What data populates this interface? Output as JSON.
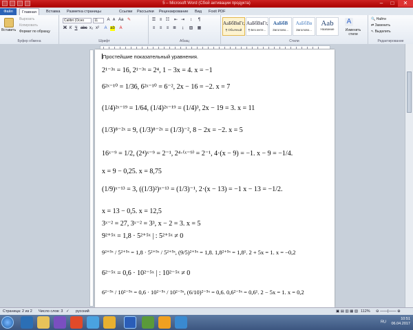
{
  "window": {
    "title": "Microsoft Word (Сбой активации продукта)",
    "title_prefix": "5",
    "controls": [
      "–",
      "□",
      "✕"
    ]
  },
  "tabs": [
    "Файл",
    "Главная",
    "Вставка",
    "Разметка страницы",
    "Ссылки",
    "Рассылки",
    "Рецензирование",
    "Вид",
    "Foxit PDF"
  ],
  "ribbon": {
    "clipboard": {
      "paste": "Вставить",
      "cut": "Вырезать",
      "copy": "Копировать",
      "format_painter": "Формат по образцу",
      "group": "Буфер обмена"
    },
    "font": {
      "font_name": "Calibri (Осно",
      "font_size": "11",
      "group": "Шрифт"
    },
    "paragraph": {
      "group": "Абзац"
    },
    "styles": {
      "items": [
        {
          "sample": "АаБбВвГг,",
          "name": "¶ Обычный"
        },
        {
          "sample": "АаБбВвГг,",
          "name": "¶ Без инте..."
        },
        {
          "sample": "АаБбВ",
          "name": "Заголово..."
        },
        {
          "sample": "АаБбВв",
          "name": "Заголово..."
        },
        {
          "sample": "Ааb",
          "name": "Название"
        }
      ],
      "change_styles": "Изменить стили",
      "group": "Стили"
    },
    "editing": {
      "find": "Найти",
      "replace": "Заменить",
      "select": "Выделить",
      "group": "Редактирование"
    }
  },
  "document": {
    "heading": "Простейшие показательный уравнения.",
    "lines": [
      "2¹⁻³ˣ = 16,   2¹⁻³ˣ = 2⁴,   1 − 3x = 4.   x = −1",
      "6²ˣ⁻¹⁰ = 1/36,   6²ˣ⁻¹⁰ = 6⁻²,   2x − 16 = −2.   x = 7",
      "(1/4)²ˣ⁻¹⁹ = 1/64,   (1/4)²ˣ⁻¹⁹ = (1/4)³,   2x − 19 = 3.   x = 11",
      "(1/3)⁸⁻²ˣ = 9,   (1/3)⁸⁻²ˣ = (1/3)⁻²,   8 − 2x = −2.   x = 5",
      "16ˣ⁻⁹ = 1/2,   (2⁴)ˣ⁻⁹ = 2⁻¹,   2⁴·⁽ˣ⁻⁹⁾ = 2⁻¹,   4·(x − 9) = −1.   x − 9 = −1/4.",
      "x = 9 − 0,25.   x = 8,75",
      "(1/9)ˣ⁻¹³ = 3,   ((1/3)²)ˣ⁻¹³ = (1/3)⁻¹,   2·(x − 13) = −1   x − 13 = −1/2.",
      "x = 13 − 0,5.   x = 12,5",
      "3ˣ⁻² = 27,   3ˣ⁻² = 3³,   x − 2 = 3.   x = 5",
      "9²⁺⁵ˣ = 1,8 · 5²⁺⁵ˣ  | : 5²⁺⁵ˣ ≠ 0",
      "9²⁺⁵ˣ / 5²⁺⁵ˣ = 1,8 · 5²⁺⁵ˣ / 5²⁺⁵ˣ,   (9/5)²⁺⁵ˣ = 1,8.   1,8²⁺⁵ˣ = 1,8¹.   2 + 5x = 1.   x = −0,2",
      "6²⁻⁵ˣ = 0,6 · 10²⁻⁵ˣ  | : 10²⁻⁵ˣ ≠ 0",
      "6²⁻⁵ˣ / 10²⁻⁵ˣ = 0,6 · 10²⁻⁵ˣ / 10²⁻⁵ˣ,   (6/10)²⁻⁵ˣ = 0,6.   0,6²⁻⁵ˣ = 0,6¹.   2 − 5x = 1.   x = 0,2"
    ]
  },
  "status": {
    "page": "Страница: 2 из 2",
    "words": "Число слов: 3",
    "language": "русский",
    "zoom": "112%"
  },
  "taskbar": {
    "lang": "RU",
    "time": "10:51",
    "date": "06.04.2017"
  },
  "colors": {
    "titlebar": "#b00000",
    "file_tab": "#2a62b7",
    "taskbar": "#3c5680"
  }
}
